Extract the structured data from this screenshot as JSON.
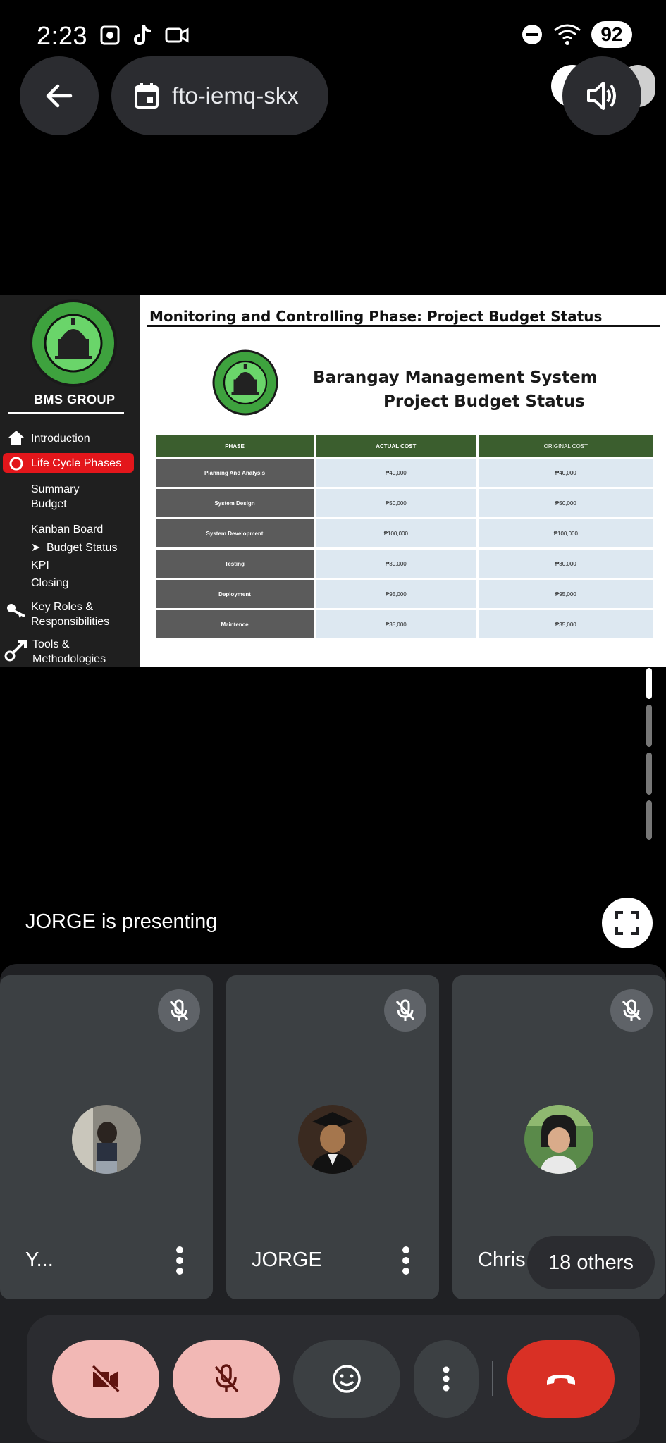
{
  "status_bar": {
    "time": "2:23",
    "battery": "92",
    "left_icons": [
      "screenshot-icon",
      "tiktok-icon",
      "video-icon"
    ],
    "right_icons": [
      "do-not-disturb-icon",
      "wifi-icon"
    ]
  },
  "meeting": {
    "code": "fto-iemq-skx",
    "presenting_text": "JORGE is presenting"
  },
  "slide": {
    "title": "Monitoring and Controlling Phase: Project Budget Status",
    "subtitle_line1": "Barangay Management System",
    "subtitle_line2": "Project Budget Status",
    "logo_text": "BARANGAY MANAGEMENT SYSTEM 2024",
    "group": "BMS GROUP",
    "menu": [
      {
        "label": "Introduction",
        "icon": "home-icon"
      },
      {
        "label": "Life Cycle Phases",
        "icon": "cycle-icon",
        "active": true
      },
      {
        "label": "Summary"
      },
      {
        "label": "Budget"
      },
      {
        "label": "Kanban Board"
      },
      {
        "label": "Budget Status",
        "prefix": "➤"
      },
      {
        "label": "KPI"
      },
      {
        "label": "Closing"
      },
      {
        "label": "Key Roles &",
        "icon": "key-icon"
      },
      {
        "label": "Responsibilities"
      },
      {
        "label": "Tools &",
        "icon": "tools-icon"
      },
      {
        "label": "Methodologies"
      }
    ],
    "table": {
      "headers": [
        "PHASE",
        "ACTUAL COST",
        "ORIGINAL COST"
      ],
      "rows": [
        [
          "Planning And Analysis",
          "₱40,000",
          "₱40,000"
        ],
        [
          "System Design",
          "₱50,000",
          "₱50,000"
        ],
        [
          "System Development",
          "₱100,000",
          "₱100,000"
        ],
        [
          "Testing",
          "₱30,000",
          "₱30,000"
        ],
        [
          "Deployment",
          "₱95,000",
          "₱95,000"
        ],
        [
          "Maintence",
          "₱35,000",
          "₱35,000"
        ]
      ]
    }
  },
  "participants": [
    {
      "name": "Y...",
      "muted": true
    },
    {
      "name": "JORGE",
      "muted": true
    },
    {
      "name": "Chris",
      "muted": true
    }
  ],
  "others_label": "18 others",
  "colors": {
    "accent_red": "#d93025",
    "muted_pink": "#f2b8b5",
    "table_header_green": "#3b5e2e",
    "menu_active_red": "#e3161b"
  }
}
